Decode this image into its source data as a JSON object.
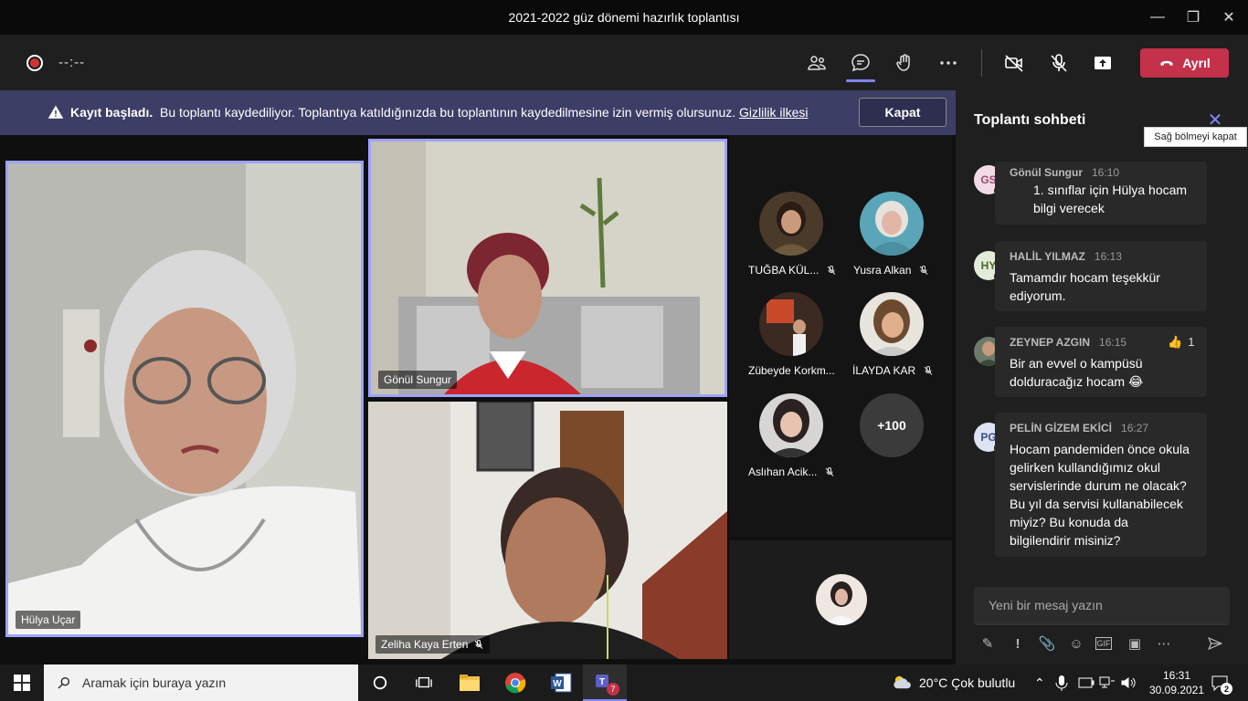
{
  "window": {
    "title": "2021-2022 güz dönemi hazırlık toplantısı"
  },
  "toolbar": {
    "timer": "--:--",
    "leave_label": "Ayrıl"
  },
  "banner": {
    "bold": "Kayıt başladı.",
    "text": "Bu toplantı kaydediliyor. Toplantıya katıldığınızda bu toplantının kaydedilmesine izin vermiş olursunuz.",
    "link": "Gizlilik ilkesi",
    "dismiss_label": "Kapat"
  },
  "videos": [
    {
      "name": "Hülya Uçar"
    },
    {
      "name": "Gönül Sungur"
    },
    {
      "name": "Zeliha Kaya Erten"
    }
  ],
  "participants": [
    {
      "name": "TUĞBA KÜL...",
      "muted": true
    },
    {
      "name": "Yusra Alkan",
      "muted": true
    },
    {
      "name": "Zübeyde Korkm...",
      "muted": false
    },
    {
      "name": "İLAYDA KAR",
      "muted": true
    },
    {
      "name": "Aslıhan Acik...",
      "muted": true
    }
  ],
  "overflow_count": "+100",
  "chat": {
    "title": "Toplantı sohbeti",
    "close_tooltip": "Sağ bölmeyi kapat",
    "messages": [
      {
        "initials": "GS",
        "author": "Gönül Sungur",
        "time": "16:10",
        "text": "1. sınıflar için Hülya hocam bilgi verecek"
      },
      {
        "initials": "HY",
        "author": "HALİL YILMAZ",
        "time": "16:13",
        "text": "Tamamdır hocam teşekkür ediyorum."
      },
      {
        "initials": "",
        "author": "ZEYNEP AZGIN",
        "time": "16:15",
        "text": "Bir an evvel o kampüsü dolduracağız hocam 😂",
        "reaction": "👍",
        "reaction_count": "1"
      },
      {
        "initials": "PG",
        "author": "PELİN GİZEM EKİCİ",
        "time": "16:27",
        "text": "Hocam pandemiden önce okula gelirken kullandığımız okul servislerinde durum ne olacak? Bu yıl da servisi kullanabilecek miyiz? Bu konuda da bilgilendirir misiniz?"
      }
    ],
    "compose_placeholder": "Yeni bir mesaj yazın"
  },
  "taskbar": {
    "search_placeholder": "Aramak için buraya yazın",
    "weather": "20°C  Çok bulutlu",
    "time": "16:31",
    "date": "30.09.2021",
    "teams_badge": "7",
    "notif_count": "2"
  },
  "colors": {
    "accent": "#7f85f5",
    "leave": "#c4314b",
    "banner": "#3d3e66"
  }
}
